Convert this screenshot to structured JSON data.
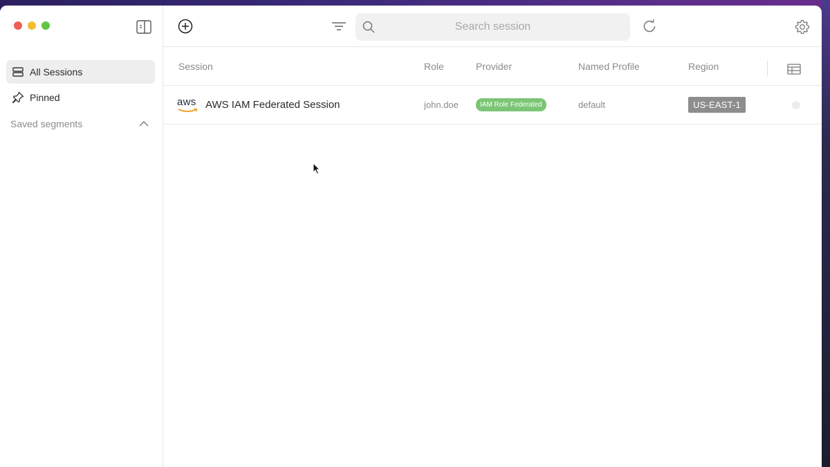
{
  "sidebar": {
    "items": [
      {
        "label": "All Sessions",
        "icon": "stack-icon",
        "active": true
      },
      {
        "label": "Pinned",
        "icon": "pin-icon",
        "active": false
      }
    ],
    "saved_segments_label": "Saved segments"
  },
  "toolbar": {
    "search_placeholder": "Search session"
  },
  "table": {
    "columns": [
      "Session",
      "Role",
      "Provider",
      "Named Profile",
      "Region"
    ],
    "rows": [
      {
        "logo_text": "aws",
        "session": "AWS IAM Federated Session",
        "role": "john.doe",
        "provider": "IAM Role Federated",
        "named_profile": "default",
        "region": "US-EAST-1"
      }
    ]
  },
  "colors": {
    "provider_badge": "#7cc576",
    "region_badge": "#8d8d8d",
    "aws_smile": "#f29a1f"
  }
}
